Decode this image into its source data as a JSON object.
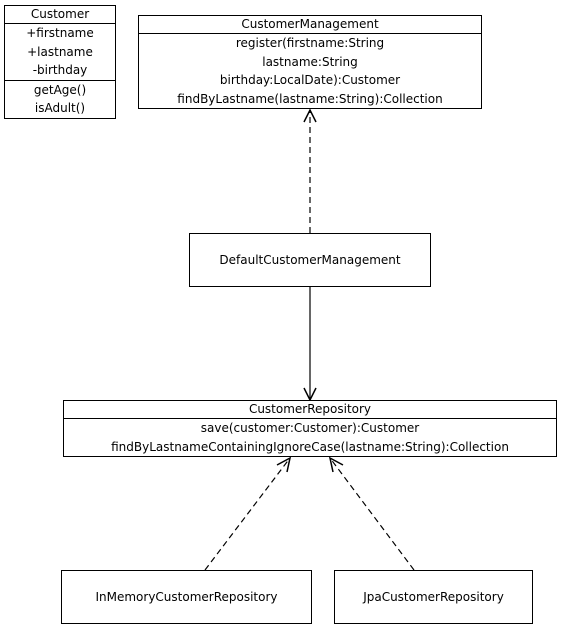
{
  "customer": {
    "name": "Customer",
    "attributes": [
      "+firstname",
      "+lastname",
      "-birthday"
    ],
    "methods": [
      "getAge()",
      "isAdult()"
    ]
  },
  "customer_management": {
    "name": "CustomerManagement",
    "methods": [
      "register(firstname:String",
      "lastname:String",
      "birthday:LocalDate):Customer",
      "findByLastname(lastname:String):Collection"
    ]
  },
  "default_customer_management": {
    "name": "DefaultCustomerManagement"
  },
  "customer_repository": {
    "name": "CustomerRepository",
    "methods": [
      "save(customer:Customer):Customer",
      "findByLastnameContainingIgnoreCase(lastname:String):Collection"
    ]
  },
  "in_memory_customer_repository": {
    "name": "InMemoryCustomerRepository"
  },
  "jpa_customer_repository": {
    "name": "JpaCustomerRepository"
  }
}
